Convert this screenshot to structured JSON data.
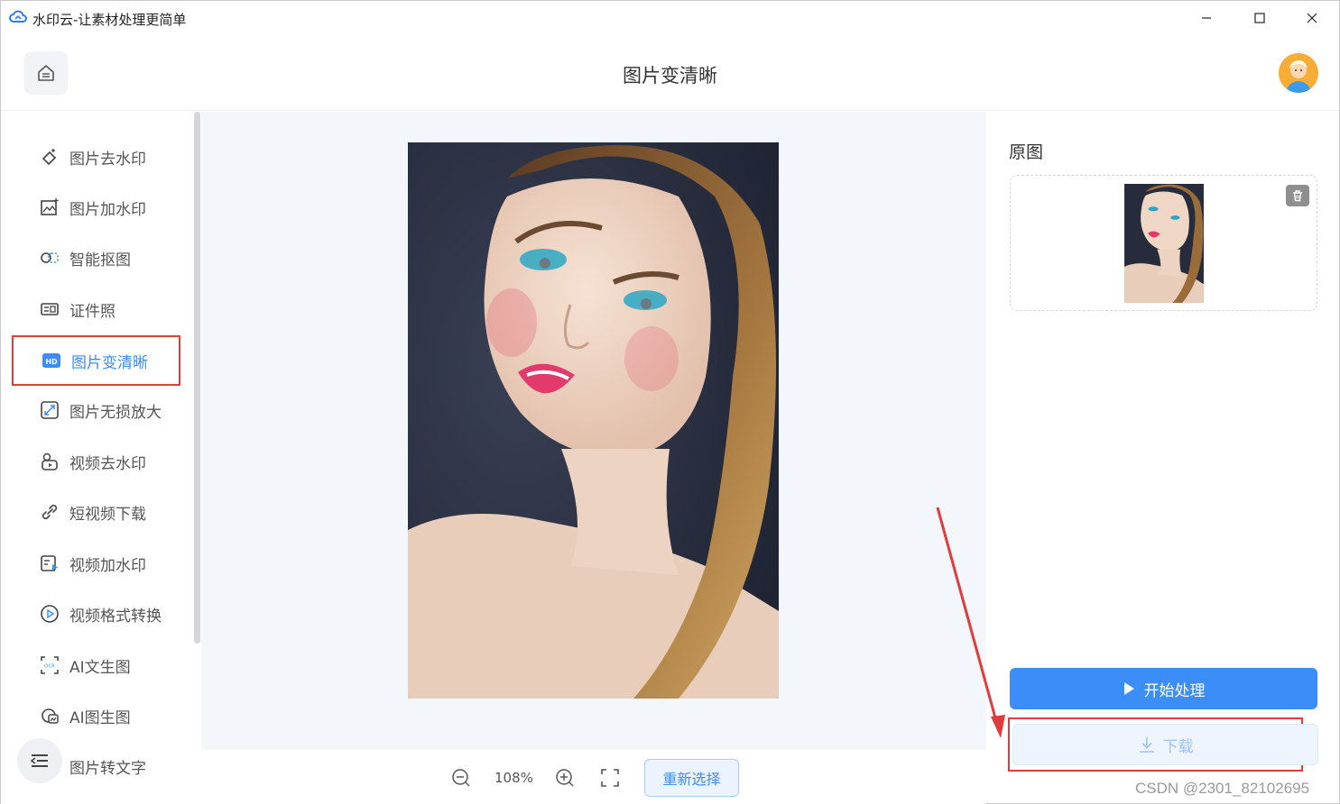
{
  "window": {
    "title": "水印云-让素材处理更简单"
  },
  "header": {
    "title": "图片变清晰"
  },
  "sidebar": {
    "items": [
      {
        "label": "图片去水印",
        "icon": "eraser-icon",
        "active": false
      },
      {
        "label": "图片加水印",
        "icon": "image-add-icon",
        "active": false
      },
      {
        "label": "智能抠图",
        "icon": "cutout-icon",
        "active": false
      },
      {
        "label": "证件照",
        "icon": "id-card-icon",
        "active": false
      },
      {
        "label": "图片变清晰",
        "icon": "hd-icon",
        "active": true
      },
      {
        "label": "图片无损放大",
        "icon": "enlarge-icon",
        "active": false
      },
      {
        "label": "视频去水印",
        "icon": "video-eraser-icon",
        "active": false
      },
      {
        "label": "短视频下载",
        "icon": "link-icon",
        "active": false
      },
      {
        "label": "视频加水印",
        "icon": "video-add-icon",
        "active": false
      },
      {
        "label": "视频格式转换",
        "icon": "play-circle-icon",
        "active": false
      },
      {
        "label": "AI文生图",
        "icon": "ocr-icon",
        "active": false
      },
      {
        "label": "AI图生图",
        "icon": "ai-image-icon",
        "active": false
      },
      {
        "label": "图片转文字",
        "icon": "image-text-icon",
        "active": false
      }
    ]
  },
  "canvas": {
    "zoom": "108%",
    "reselect_label": "重新选择"
  },
  "right_panel": {
    "original_label": "原图",
    "start_label": "开始处理",
    "download_label": "下载"
  },
  "watermark": "CSDN @2301_82102695",
  "colors": {
    "accent": "#3b8ef7",
    "highlight": "#e23b3b"
  }
}
